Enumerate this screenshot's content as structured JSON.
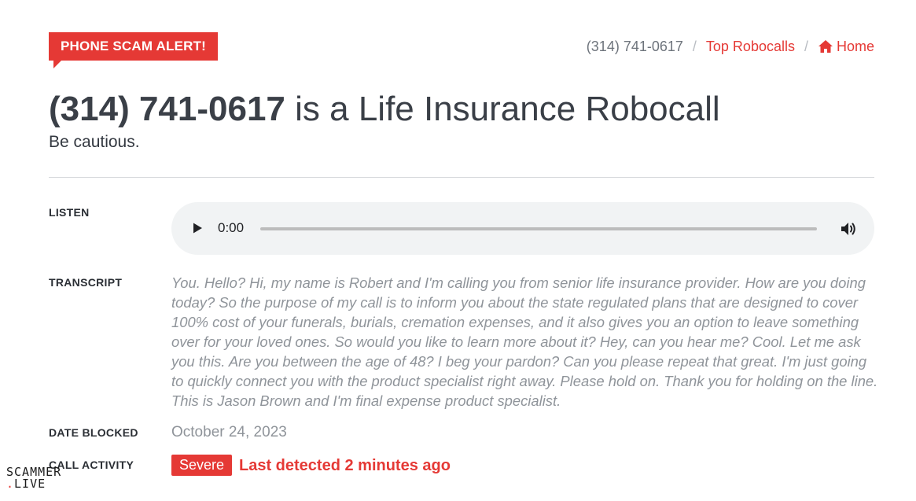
{
  "alert_badge": "PHONE SCAM ALERT!",
  "breadcrumb": {
    "current": "(314) 741-0617",
    "separator": "/",
    "top_robocalls": "Top Robocalls",
    "home": "Home"
  },
  "title": {
    "number": "(314) 741-0617",
    "rest": "is a Life Insurance Robocall"
  },
  "subtitle": "Be cautious.",
  "listen": {
    "label": "LISTEN",
    "time": "0:00"
  },
  "transcript": {
    "label": "TRANSCRIPT",
    "text": "You. Hello? Hi, my name is Robert and I'm calling you from senior life insurance provider. How are you doing today? So the purpose of my call is to inform you about the state regulated plans that are designed to cover 100% cost of your funerals, burials, cremation expenses, and it also gives you an option to leave something over for your loved ones. So would you like to learn more about it? Hey, can you hear me? Cool. Let me ask you this. Are you between the age of 48? I beg your pardon? Can you please repeat that great. I'm just going to quickly connect you with the product specialist right away. Please hold on. Thank you for holding on the line. This is Jason Brown and I'm final expense product specialist."
  },
  "date_blocked": {
    "label": "DATE BLOCKED",
    "value": "October 24, 2023"
  },
  "call_activity": {
    "label": "CALL ACTIVITY",
    "severity": "Severe",
    "last_detected": "Last detected 2 minutes ago"
  },
  "watermark": {
    "line1": "SCAMMER",
    "dot": ".",
    "line2": "LIVE"
  },
  "colors": {
    "accent": "#e53935",
    "text": "#333840",
    "muted": "#8f949a",
    "player_bg": "#f1f3f4"
  },
  "icons": {
    "home": "home-icon",
    "play": "play-icon",
    "volume": "volume-icon"
  }
}
